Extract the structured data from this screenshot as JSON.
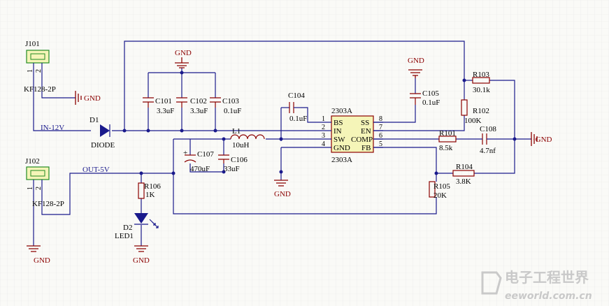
{
  "connectors": {
    "j101": {
      "ref": "J101",
      "part": "KF128-2P",
      "pins": [
        "1",
        "2"
      ]
    },
    "j102": {
      "ref": "J102",
      "part": "KF128-2P",
      "pins": [
        "1",
        "2"
      ]
    }
  },
  "nets": {
    "input": "IN-12V",
    "output": "OUT-5V",
    "ground": "GND"
  },
  "diodes": {
    "d1": {
      "ref": "D1",
      "value": "DIODE"
    },
    "d2": {
      "ref": "D2",
      "value": "LED1"
    }
  },
  "capacitors": {
    "c101": {
      "ref": "C101",
      "value": "3.3uF"
    },
    "c102": {
      "ref": "C102",
      "value": "3.3uF"
    },
    "c103": {
      "ref": "C103",
      "value": "0.1uF"
    },
    "c104": {
      "ref": "C104",
      "value": "0.1uF"
    },
    "c105": {
      "ref": "C105",
      "value": "0.1uF"
    },
    "c106": {
      "ref": "C106",
      "value": "33uF"
    },
    "c107": {
      "ref": "C107",
      "value": "470uF"
    },
    "c108": {
      "ref": "C108",
      "value": "4.7nf"
    }
  },
  "inductor": {
    "ref": "L1",
    "value": "10uH"
  },
  "resistors": {
    "r101": {
      "ref": "R101",
      "value": "8.5k"
    },
    "r102": {
      "ref": "R102",
      "value": "100K"
    },
    "r103": {
      "ref": "R103",
      "value": "30.1k"
    },
    "r104": {
      "ref": "R104",
      "value": "3.8K"
    },
    "r105": {
      "ref": "R105",
      "value": "20K"
    },
    "r106": {
      "ref": "R106",
      "value": "1K"
    }
  },
  "ic": {
    "name_top": "2303A",
    "name_bottom": "2303A",
    "left_pins": [
      {
        "num": "1",
        "name": "BS"
      },
      {
        "num": "2",
        "name": "IN"
      },
      {
        "num": "3",
        "name": "SW"
      },
      {
        "num": "4",
        "name": "GND"
      }
    ],
    "right_pins": [
      {
        "num": "8",
        "name": "SS"
      },
      {
        "num": "7",
        "name": "EN"
      },
      {
        "num": "6",
        "name": "COMP"
      },
      {
        "num": "5",
        "name": "FB"
      }
    ]
  },
  "watermark": {
    "cn": "电子工程世界",
    "url": "eeworld.com.cn"
  },
  "colors": {
    "wire": "#1a1a8c",
    "part": "#8b0000",
    "connector_fill": "#f5f5b8",
    "grid": "#e8e8e8"
  }
}
